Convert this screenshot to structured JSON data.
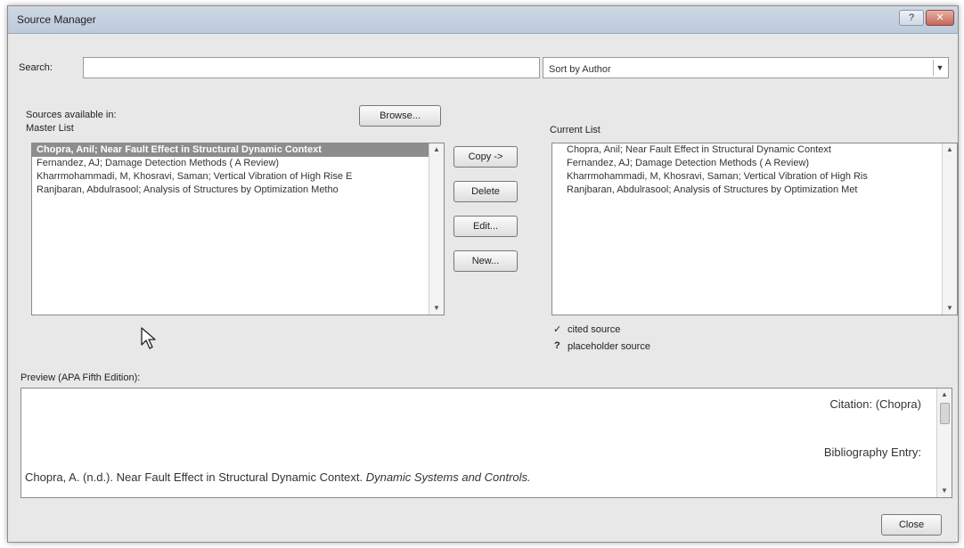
{
  "window": {
    "title": "Source Manager",
    "help_label": "?",
    "close_label": "✕"
  },
  "search": {
    "label": "Search:",
    "value": "",
    "placeholder": ""
  },
  "sort": {
    "selected": "Sort by Author"
  },
  "sources_available_label": "Sources available in:",
  "master_list": {
    "label": "Master List",
    "items": [
      "Chopra, Anil; Near Fault Effect in Structural Dynamic Context",
      "Fernandez, AJ; Damage Detection Methods ( A Review)",
      "Kharrmohammadi, M, Khosravi, Saman; Vertical Vibration of High Rise E",
      "Ranjbaran, Abdulrasool; Analysis of Structures by Optimization Metho"
    ],
    "selected_index": 0
  },
  "buttons": {
    "browse": "Browse...",
    "copy": "Copy ->",
    "delete": "Delete",
    "edit": "Edit...",
    "new": "New...",
    "close": "Close"
  },
  "current_list": {
    "label": "Current List",
    "items": [
      "Chopra, Anil; Near Fault Effect in Structural Dynamic Context",
      "Fernandez, AJ; Damage Detection Methods ( A Review)",
      "Kharrmohammadi, M, Khosravi, Saman; Vertical Vibration of High Ris",
      "Ranjbaran, Abdulrasool; Analysis of Structures by Optimization Met"
    ]
  },
  "legend": {
    "cited_symbol": "✓",
    "cited_label": "cited source",
    "placeholder_symbol": "?",
    "placeholder_label": "placeholder source"
  },
  "preview": {
    "label": "Preview (APA Fifth Edition):",
    "citation": "Citation:  (Chopra)",
    "bibliography_label": "Bibliography Entry:",
    "entry_text": "Chopra, A. (n.d.). Near Fault Effect in Structural Dynamic Context. ",
    "entry_italic": "Dynamic Systems and Controls."
  },
  "icons": [
    "mouse-pointer-icon",
    "checkmark-icon",
    "question-mark-icon"
  ],
  "colors": {
    "title_bar": "#c7d2e0",
    "dialog_bg": "#e8e8e8",
    "selection": "#8d8d8d",
    "close_button": "#c4665a"
  }
}
